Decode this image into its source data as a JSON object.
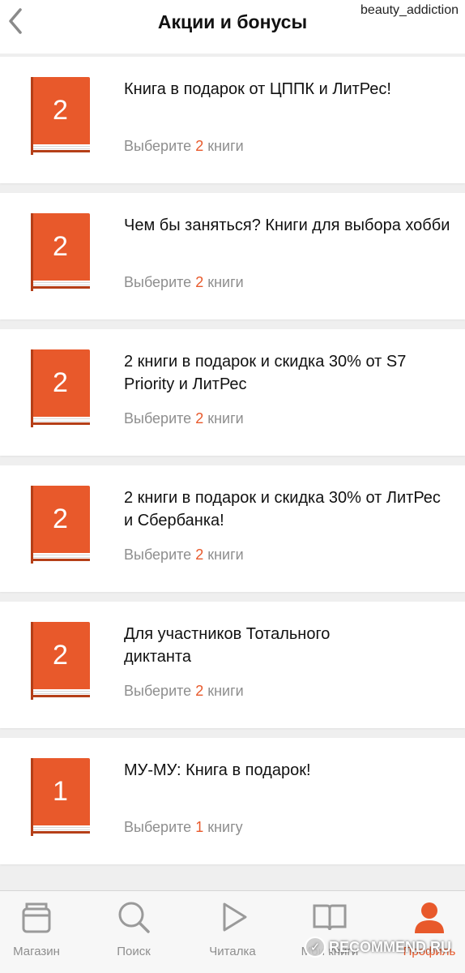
{
  "header": {
    "title": "Акции и бонусы",
    "back_icon": "chevron-left-icon",
    "watermark_user": "beauty_addiction"
  },
  "promos": [
    {
      "count": "2",
      "title": "Книга в подарок от ЦППК и ЛитРес!",
      "sub_prefix": "Выберите",
      "sub_num": "2",
      "sub_suffix": "книги"
    },
    {
      "count": "2",
      "title": "Чем бы заняться? Книги для выбора хобби",
      "sub_prefix": "Выберите",
      "sub_num": "2",
      "sub_suffix": "книги"
    },
    {
      "count": "2",
      "title": "2 книги в подарок и скидка 30%  от S7 Priority и ЛитРес",
      "sub_prefix": "Выберите",
      "sub_num": "2",
      "sub_suffix": "книги"
    },
    {
      "count": "2",
      "title": "2 книги в подарок и скидка 30% от ЛитРес и Сбербанка!",
      "sub_prefix": "Выберите",
      "sub_num": "2",
      "sub_suffix": "книги"
    },
    {
      "count": "2",
      "title": "Для участников Тотального диктанта",
      "sub_prefix": "Выберите",
      "sub_num": "2",
      "sub_suffix": "книги"
    },
    {
      "count": "1",
      "title": "МУ-МУ: Книга в подарок!",
      "sub_prefix": "Выберите",
      "sub_num": "1",
      "sub_suffix": "книгу"
    }
  ],
  "tabs": [
    {
      "label": "Магазин",
      "icon": "store-icon"
    },
    {
      "label": "Поиск",
      "icon": "search-icon"
    },
    {
      "label": "Читалка",
      "icon": "play-icon"
    },
    {
      "label": "Мои книги",
      "icon": "open-book-icon"
    },
    {
      "label": "Профиль",
      "icon": "profile-icon"
    }
  ],
  "watermark_site": "RECOMMEND.RU",
  "colors": {
    "accent": "#e8592b",
    "muted": "#8e8e8e",
    "background": "#efefef"
  }
}
